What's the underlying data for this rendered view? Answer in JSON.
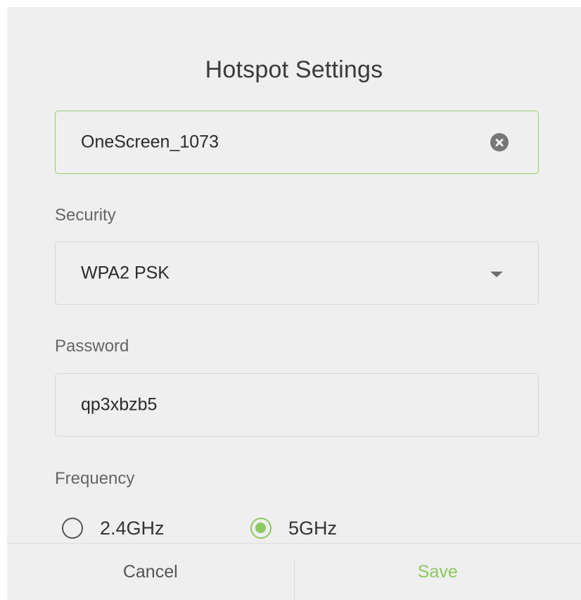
{
  "dialog": {
    "title": "Hotspot Settings"
  },
  "ssid": {
    "value": "OneScreen_1073",
    "clear_icon": "clear-circle-icon"
  },
  "security": {
    "label": "Security",
    "selected": "WPA2 PSK",
    "dropdown_icon": "caret-down-icon"
  },
  "password": {
    "label": "Password",
    "value": "qp3xbzb5"
  },
  "frequency": {
    "label": "Frequency",
    "options": [
      {
        "label": "2.4GHz",
        "checked": false
      },
      {
        "label": "5GHz",
        "checked": true
      }
    ]
  },
  "actions": {
    "cancel_label": "Cancel",
    "save_label": "Save"
  },
  "colors": {
    "accent": "#8cc860",
    "focus_border": "#9cc96b",
    "background": "#efefef"
  }
}
